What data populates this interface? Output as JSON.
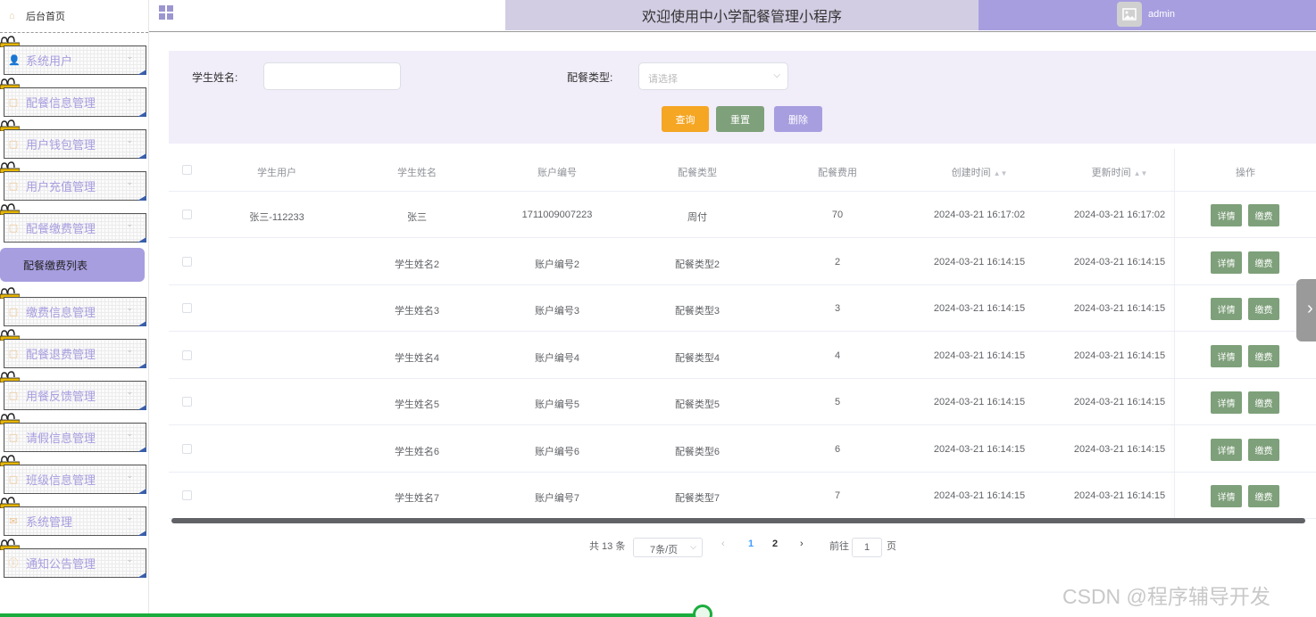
{
  "sidebar": {
    "home_label": "后台首页",
    "items": [
      {
        "label": "系统用户",
        "icon": "user-icon"
      },
      {
        "label": "配餐信息管理",
        "icon": "document-icon"
      },
      {
        "label": "用户钱包管理",
        "icon": "document-icon"
      },
      {
        "label": "用户充值管理",
        "icon": "document-icon"
      },
      {
        "label": "配餐缴费管理",
        "icon": "document-icon"
      },
      {
        "label": "缴费信息管理",
        "icon": "document-icon"
      },
      {
        "label": "配餐退费管理",
        "icon": "document-icon"
      },
      {
        "label": "用餐反馈管理",
        "icon": "document-icon"
      },
      {
        "label": "请假信息管理",
        "icon": "document-icon"
      },
      {
        "label": "班级信息管理",
        "icon": "document-icon"
      },
      {
        "label": "系统管理",
        "icon": "mail-icon"
      },
      {
        "label": "通知公告管理",
        "icon": "info-icon"
      }
    ],
    "active_submenu": "配餐缴费列表"
  },
  "header": {
    "title": "欢迎使用中小学配餐管理小程序",
    "username": "admin"
  },
  "search": {
    "student_name_label": "学生姓名:",
    "student_name_value": "",
    "meal_type_label": "配餐类型:",
    "meal_type_placeholder": "请选择",
    "query_btn": "查询",
    "reset_btn": "重置",
    "delete_btn": "删除"
  },
  "colors": {
    "accent": "#a79ee0",
    "query_btn": "#f5a623",
    "reset_btn": "#7ea07a",
    "delete_btn": "#a79ee0",
    "row_btn": "#7ea07a"
  },
  "table": {
    "headers": [
      "学生用户",
      "学生姓名",
      "账户编号",
      "配餐类型",
      "配餐费用",
      "创建时间",
      "更新时间",
      "操作"
    ],
    "rows": [
      {
        "user": "张三-112233",
        "name": "张三",
        "account": "1711009007223",
        "type": "周付",
        "fee": "70",
        "created": "2024-03-21 16:17:02",
        "updated": "2024-03-21 16:17:02"
      },
      {
        "user": "",
        "name": "学生姓名2",
        "account": "账户编号2",
        "type": "配餐类型2",
        "fee": "2",
        "created": "2024-03-21 16:14:15",
        "updated": "2024-03-21 16:14:15"
      },
      {
        "user": "",
        "name": "学生姓名3",
        "account": "账户编号3",
        "type": "配餐类型3",
        "fee": "3",
        "created": "2024-03-21 16:14:15",
        "updated": "2024-03-21 16:14:15"
      },
      {
        "user": "",
        "name": "学生姓名4",
        "account": "账户编号4",
        "type": "配餐类型4",
        "fee": "4",
        "created": "2024-03-21 16:14:15",
        "updated": "2024-03-21 16:14:15"
      },
      {
        "user": "",
        "name": "学生姓名5",
        "account": "账户编号5",
        "type": "配餐类型5",
        "fee": "5",
        "created": "2024-03-21 16:14:15",
        "updated": "2024-03-21 16:14:15"
      },
      {
        "user": "",
        "name": "学生姓名6",
        "account": "账户编号6",
        "type": "配餐类型6",
        "fee": "6",
        "created": "2024-03-21 16:14:15",
        "updated": "2024-03-21 16:14:15"
      },
      {
        "user": "",
        "name": "学生姓名7",
        "account": "账户编号7",
        "type": "配餐类型7",
        "fee": "7",
        "created": "2024-03-21 16:14:15",
        "updated": "2024-03-21 16:14:15"
      }
    ],
    "detail_btn": "详情",
    "pay_btn": "缴费"
  },
  "pagination": {
    "total": "共 13 条",
    "page_size": "7条/页",
    "pages": [
      "1",
      "2"
    ],
    "current": "1",
    "goto_label": "前往",
    "goto_value": "1",
    "page_unit": "页"
  },
  "watermark": "CSDN @程序辅导开发"
}
